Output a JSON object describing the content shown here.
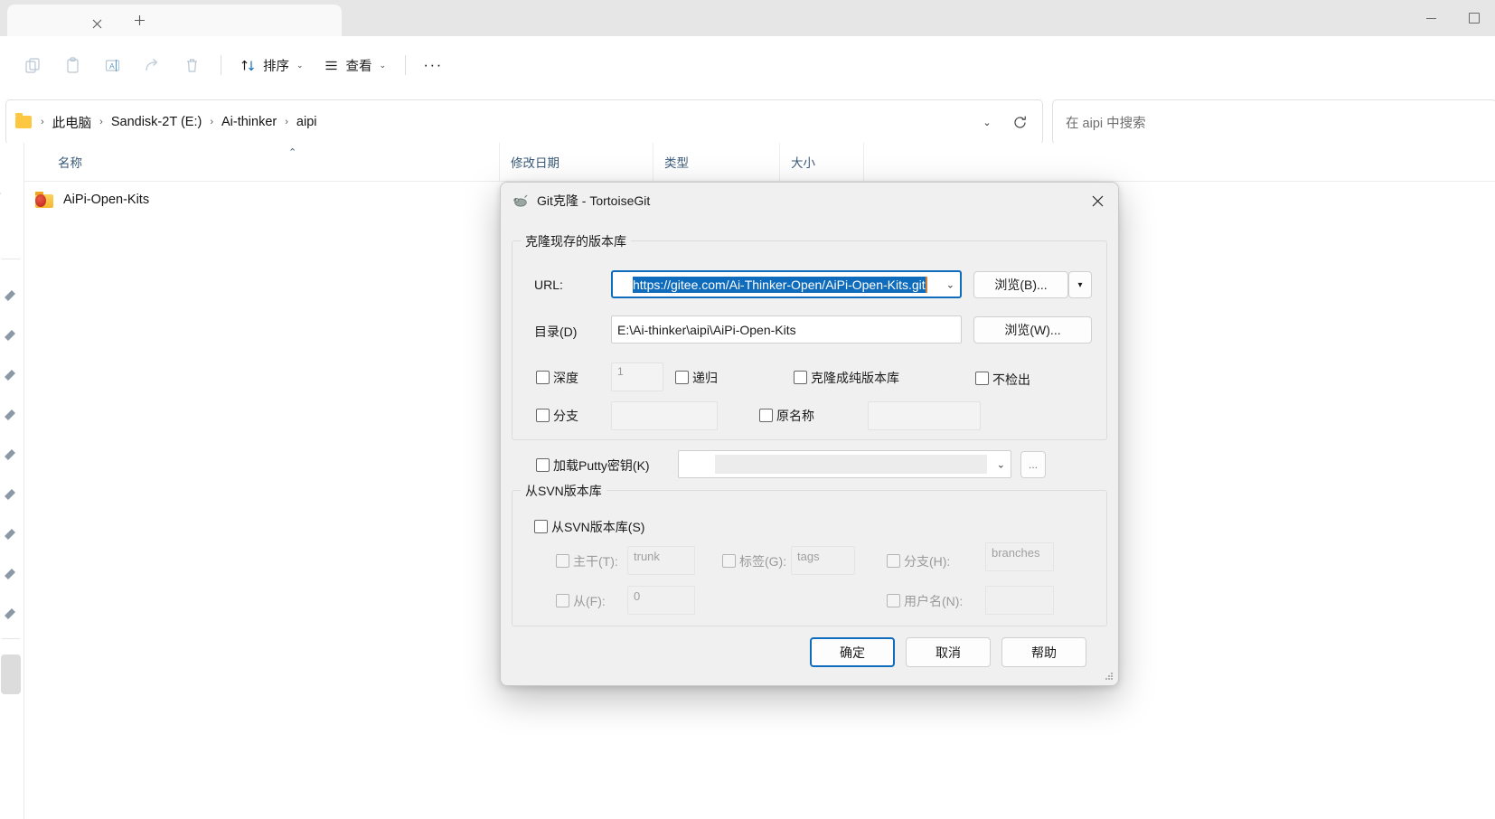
{
  "window": {
    "tab_close_icon": "close-icon",
    "new_tab_icon": "plus-icon",
    "minimize_label": "—",
    "maximize_label": "□"
  },
  "toolbar": {
    "icons": [
      {
        "name": "copy-icon",
        "label": "复制"
      },
      {
        "name": "paste-icon",
        "label": "粘贴"
      },
      {
        "name": "rename-icon",
        "label": "重命名"
      },
      {
        "name": "share-icon",
        "label": "共享"
      },
      {
        "name": "delete-icon",
        "label": "删除"
      }
    ],
    "sort_label": "排序",
    "view_label": "查看",
    "more_label": "···"
  },
  "address": {
    "crumbs": [
      "此电脑",
      "Sandisk-2T (E:)",
      "Ai-thinker",
      "aipi"
    ],
    "separator": "›",
    "dropdown_icon": "chevron-down-icon",
    "refresh_icon": "refresh-icon"
  },
  "search": {
    "placeholder": "在 aipi 中搜索"
  },
  "filelist": {
    "columns": [
      "名称",
      "修改日期",
      "类型",
      "大小"
    ],
    "sort_caret": "⌃",
    "rows": [
      {
        "name": "AiPi-Open-Kits",
        "modified": "",
        "type": "",
        "size": ""
      }
    ]
  },
  "sidebar": {
    "clipped_label": "or",
    "pin_icon": "pin-icon",
    "pin_count": 9
  },
  "dialog": {
    "title": "Git克隆 - TortoiseGit",
    "app_icon": "tortoisegit-icon",
    "close_icon": "close-icon",
    "group_clone": {
      "legend": "克隆现存的版本库",
      "url_label": "URL:",
      "url_value": "https://gitee.com/Ai-Thinker-Open/AiPi-Open-Kits.git",
      "url_selected": true,
      "browse_b_label": "浏览(B)...",
      "browse_b_arrow": "chevron-down-icon",
      "dir_label": "目录(D)",
      "dir_value": "E:\\Ai-thinker\\aipi\\AiPi-Open-Kits",
      "browse_w_label": "浏览(W)...",
      "depth_label": "深度",
      "depth_checked": false,
      "depth_value": "1",
      "recursive_label": "递归",
      "recursive_checked": false,
      "bare_label": "克隆成纯版本库",
      "bare_checked": false,
      "nocheckout_label": "不检出",
      "nocheckout_checked": false,
      "branch_label": "分支",
      "branch_checked": false,
      "branch_value": "",
      "origin_label": "原名称",
      "origin_checked": false,
      "origin_value": ""
    },
    "putty": {
      "label": "加载Putty密钥(K)",
      "checked": false,
      "value": "",
      "browse_label": "..."
    },
    "group_svn": {
      "legend": "从SVN版本库",
      "from_svn_label": "从SVN版本库(S)",
      "from_svn_checked": false,
      "trunk_label": "主干(T):",
      "trunk_checked": false,
      "trunk_value": "trunk",
      "tags_label": "标签(G):",
      "tags_checked": false,
      "tags_value": "tags",
      "branches_label": "分支(H):",
      "branches_checked": false,
      "branches_value": "branches",
      "from_label": "从(F):",
      "from_checked": false,
      "from_value": "0",
      "username_label": "用户名(N):",
      "username_checked": false,
      "username_value": ""
    },
    "buttons": {
      "ok": "确定",
      "cancel": "取消",
      "help": "帮助"
    },
    "resize_grip": "resize-grip-icon"
  },
  "colors": {
    "accent": "#0f6cbd",
    "dialog_bg": "#f0f0f0",
    "header_text": "#3a5a78"
  }
}
